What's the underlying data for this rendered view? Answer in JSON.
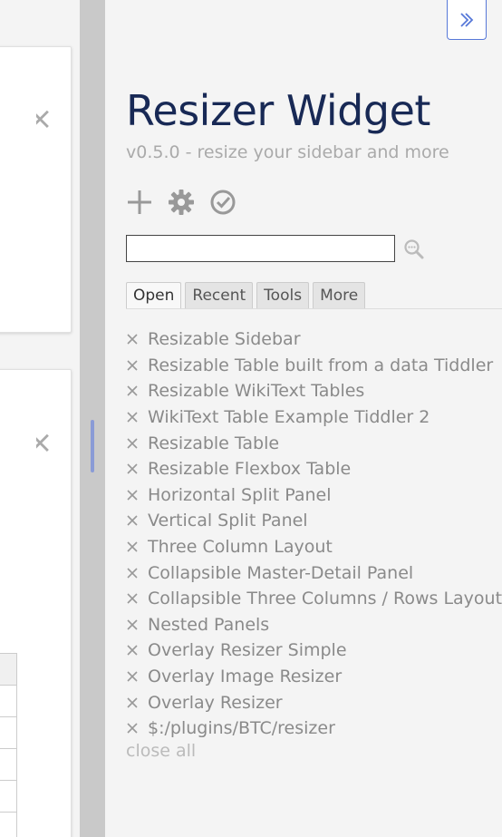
{
  "sidebar": {
    "toggle_icon": "chevron-double-right-icon",
    "title": "Resizer Widget",
    "subtitle": "v0.5.0 - resize your sidebar and more",
    "controls": [
      "new-tiddler-icon",
      "control-panel-icon",
      "save-icon"
    ],
    "search": {
      "value": "",
      "placeholder": ""
    },
    "tabs": [
      {
        "label": "Open",
        "active": true
      },
      {
        "label": "Recent",
        "active": false
      },
      {
        "label": "Tools",
        "active": false
      },
      {
        "label": "More",
        "active": false
      }
    ],
    "open_items": [
      "Resizable Sidebar",
      "Resizable Table built from a data Tiddler",
      "Resizable WikiText Tables",
      "WikiText Table Example Tiddler 2",
      "Resizable Table",
      "Resizable Flexbox Table",
      "Horizontal Split Panel",
      "Vertical Split Panel",
      "Three Column Layout",
      "Collapsible Master-Detail Panel",
      "Collapsible Three Columns / Rows Layout",
      "Nested Panels",
      "Overlay Resizer Simple",
      "Overlay Image Resizer",
      "Overlay Resizer",
      "$:/plugins/BTC/resizer"
    ],
    "close_all": "close all"
  },
  "colors": {
    "title": "#182955",
    "accent": "#5778d8",
    "muted_text": "#8a8a8a",
    "gutter": "#c9c9c9",
    "gutter_handle": "#8a9bd6"
  }
}
